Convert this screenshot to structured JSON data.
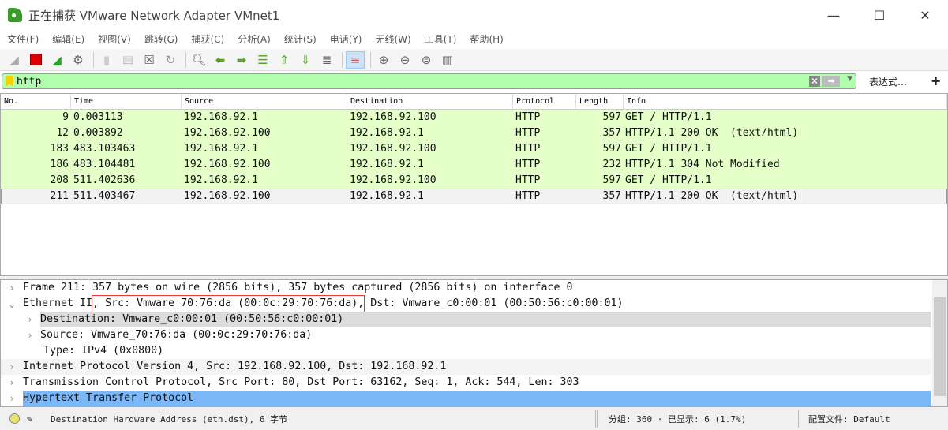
{
  "window": {
    "title": "正在捕获 VMware Network Adapter VMnet1",
    "minimize": "—",
    "maximize": "☐",
    "close": "✕"
  },
  "menu": [
    "文件(F)",
    "编辑(E)",
    "视图(V)",
    "跳转(G)",
    "捕获(C)",
    "分析(A)",
    "统计(S)",
    "电话(Y)",
    "无线(W)",
    "工具(T)",
    "帮助(H)"
  ],
  "toolbar": [
    "shark-fin-icon",
    "stop-icon",
    "restart-icon",
    "options-icon",
    "open-icon",
    "save-icon",
    "close-file-icon",
    "reload-icon",
    "find-icon",
    "back-icon",
    "forward-icon",
    "goto-icon",
    "first-icon",
    "last-icon",
    "autoscroll-icon",
    "colorize-icon",
    "zoom-in-icon",
    "zoom-out-icon",
    "zoom-reset-icon",
    "resize-columns-icon"
  ],
  "filter": {
    "value": "http",
    "expression_label": "表达式…",
    "add_label": "+"
  },
  "packet_list": {
    "columns": [
      "No.",
      "Time",
      "Source",
      "Destination",
      "Protocol",
      "Length",
      "Info"
    ],
    "rows": [
      [
        "9",
        "0.003113",
        "192.168.92.1",
        "192.168.92.100",
        "HTTP",
        "597",
        "GET / HTTP/1.1"
      ],
      [
        "12",
        "0.003892",
        "192.168.92.100",
        "192.168.92.1",
        "HTTP",
        "357",
        "HTTP/1.1 200 OK  (text/html)"
      ],
      [
        "183",
        "483.103463",
        "192.168.92.1",
        "192.168.92.100",
        "HTTP",
        "597",
        "GET / HTTP/1.1"
      ],
      [
        "186",
        "483.104481",
        "192.168.92.100",
        "192.168.92.1",
        "HTTP",
        "232",
        "HTTP/1.1 304 Not Modified"
      ],
      [
        "208",
        "511.402636",
        "192.168.92.1",
        "192.168.92.100",
        "HTTP",
        "597",
        "GET / HTTP/1.1"
      ],
      [
        "211",
        "511.403467",
        "192.168.92.100",
        "192.168.92.1",
        "HTTP",
        "357",
        "HTTP/1.1 200 OK  (text/html)"
      ]
    ],
    "selected_row": 5,
    "colors": {
      "http_row": "#e4ffc7"
    }
  },
  "details": {
    "frame": "Frame 211: 357 bytes on wire (2856 bits), 357 bytes captured (2856 bits) on interface 0",
    "eth_a": "Ethernet II",
    "eth_b": ", Src: Vmware_70:76:da (00:0c:29:70:76:da),",
    "eth_c": " Dst: Vmware_c0:00:01 (00:50:56:c0:00:01)",
    "eth_dst": "Destination: Vmware_c0:00:01 (00:50:56:c0:00:01)",
    "eth_src": "Source: Vmware_70:76:da (00:0c:29:70:76:da)",
    "eth_type": "Type: IPv4 (0x0800)",
    "ip": "Internet Protocol Version 4, Src: 192.168.92.100, Dst: 192.168.92.1",
    "tcp": "Transmission Control Protocol, Src Port: 80, Dst Port: 63162, Seq: 1, Ack: 544, Len: 303",
    "http": "Hypertext Transfer Protocol"
  },
  "status": {
    "field": "Destination Hardware Address (eth.dst), 6 字节",
    "packets": "分组: 360 · 已显示: 6 (1.7%)",
    "profile": "配置文件: Default"
  }
}
